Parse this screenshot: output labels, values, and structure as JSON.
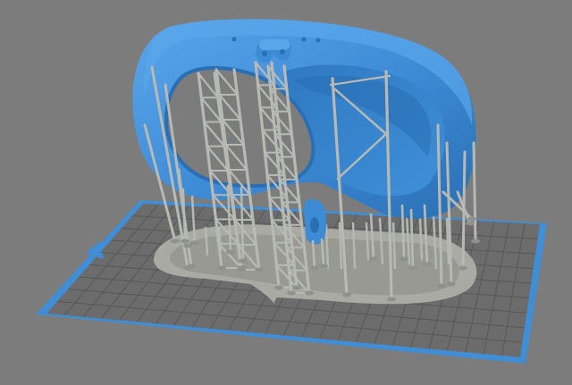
{
  "viewport": {
    "background": "#7c7c7c",
    "build_plate_border": "#3f8ed6",
    "build_plate_fill": "#6c6c6c",
    "grid_line": "#5a5a5a",
    "raft": "#a9aaa4",
    "support": "#b7bab4",
    "model": "#3d8ad5",
    "model_dark": "#2a6fb4",
    "model_light": "#5aa6eb"
  }
}
